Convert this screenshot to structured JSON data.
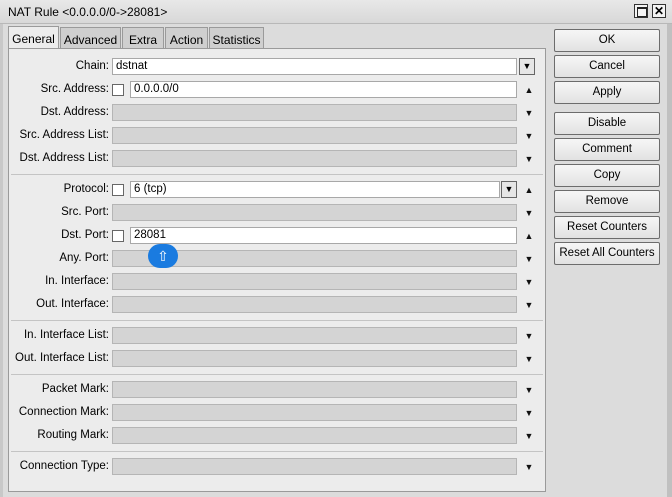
{
  "window": {
    "title": "NAT Rule <0.0.0.0/0->28081>"
  },
  "tabs": [
    "General",
    "Advanced",
    "Extra",
    "Action",
    "Statistics"
  ],
  "fields": {
    "chain": {
      "label": "Chain:",
      "value": "dstnat"
    },
    "src_address": {
      "label": "Src. Address:",
      "value": "0.0.0.0/0"
    },
    "dst_address": {
      "label": "Dst. Address:"
    },
    "src_address_list": {
      "label": "Src. Address List:"
    },
    "dst_address_list": {
      "label": "Dst. Address List:"
    },
    "protocol": {
      "label": "Protocol:",
      "value": "6 (tcp)"
    },
    "src_port": {
      "label": "Src. Port:"
    },
    "dst_port": {
      "label": "Dst. Port:",
      "value": "28081"
    },
    "any_port": {
      "label": "Any. Port:"
    },
    "in_interface": {
      "label": "In. Interface:"
    },
    "out_interface": {
      "label": "Out. Interface:"
    },
    "in_interface_list": {
      "label": "In. Interface List:"
    },
    "out_interface_list": {
      "label": "Out. Interface List:"
    },
    "packet_mark": {
      "label": "Packet Mark:"
    },
    "connection_mark": {
      "label": "Connection Mark:"
    },
    "routing_mark": {
      "label": "Routing Mark:"
    },
    "connection_type": {
      "label": "Connection Type:"
    }
  },
  "buttons": {
    "ok": "OK",
    "cancel": "Cancel",
    "apply": "Apply",
    "disable": "Disable",
    "comment": "Comment",
    "copy": "Copy",
    "remove": "Remove",
    "reset_counters": "Reset Counters",
    "reset_all_counters": "Reset All Counters"
  },
  "icons": {
    "dropdown": "dropdown-arrow-icon",
    "expand": "triangle-up-icon",
    "collapse": "triangle-down-icon",
    "cursor": "arrow-up-cursor-icon"
  },
  "colors": {
    "accent": "#1a7be0"
  }
}
